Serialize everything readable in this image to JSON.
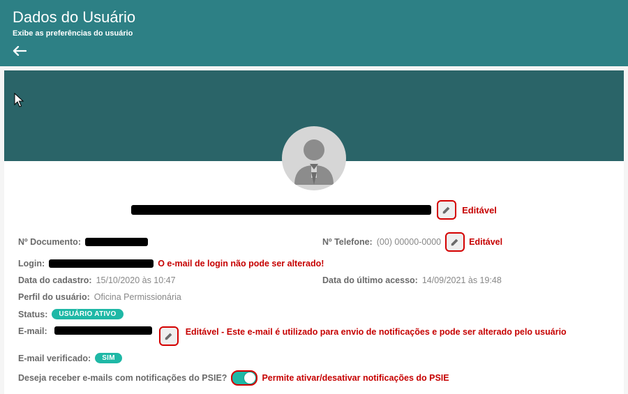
{
  "header": {
    "title": "Dados do Usuário",
    "subtitle": "Exibe as preferências do usuário",
    "back_icon": "arrow-left"
  },
  "annotations": {
    "editable": "Editável",
    "login_locked": "O e-mail de login não pode ser alterado!",
    "email_editable": "Editável - Este e-mail é utilizado para envio de notificações e pode ser alterado pelo usuário",
    "toggle_note": "Permite ativar/desativar notificações do PSIE"
  },
  "fields": {
    "documento_label": "Nº Documento:",
    "telefone_label": "Nº Telefone:",
    "telefone_value": "(00) 00000-0000",
    "login_label": "Login:",
    "cadastro_label": "Data do cadastro:",
    "cadastro_value": "15/10/2020 às 10:47",
    "ultimo_acesso_label": "Data do último acesso:",
    "ultimo_acesso_value": "14/09/2021 às 19:48",
    "perfil_label": "Perfil do usuário:",
    "perfil_value": "Oficina Permissionária",
    "status_label": "Status:",
    "status_badge": "USUÁRIO ATIVO",
    "email_label": "E-mail:",
    "email_verificado_label": "E-mail verificado:",
    "email_verificado_badge": "SIM",
    "notificacoes_label": "Deseja receber e-mails com notificações do PSIE?"
  },
  "colors": {
    "teal_header": "#2d8085",
    "teal_banner": "#2a6468",
    "badge": "#1fb8a6",
    "annotation_red": "#c60000"
  },
  "avatar": {
    "type": "placeholder-person"
  },
  "toggle": {
    "notifications_on": true
  }
}
